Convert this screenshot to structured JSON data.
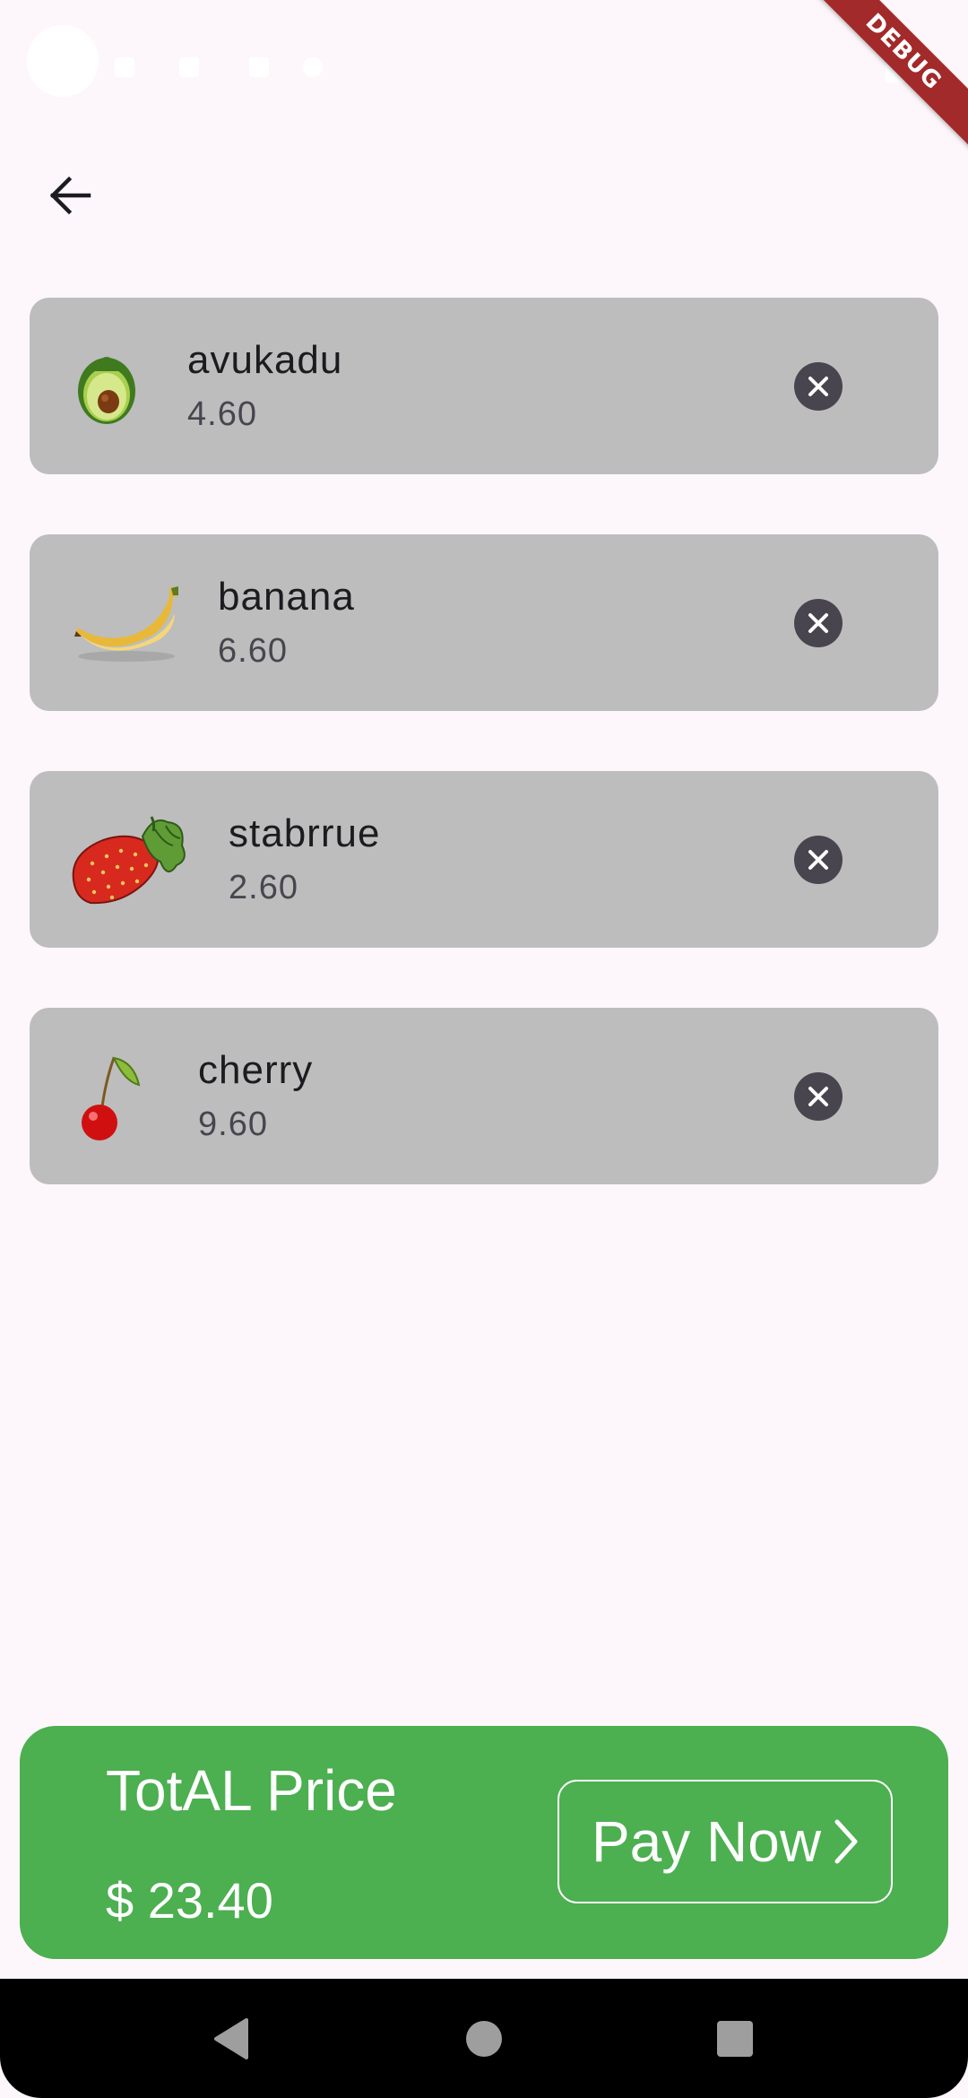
{
  "app": {
    "debug_banner": "DEBUG"
  },
  "icons": {
    "back": "arrow-left-icon",
    "remove": "close-circle-icon",
    "pay_chevron": "chevron-right-icon",
    "nav_back": "triangle-back-icon",
    "nav_home": "circle-home-icon",
    "nav_recents": "square-recents-icon"
  },
  "cart": {
    "items": [
      {
        "name": "avukadu",
        "price": "4.60",
        "image": "avocado"
      },
      {
        "name": "banana",
        "price": "6.60",
        "image": "banana"
      },
      {
        "name": "stabrrue",
        "price": "2.60",
        "image": "strawberry"
      },
      {
        "name": "cherry",
        "price": "9.60",
        "image": "cherry"
      }
    ]
  },
  "checkout": {
    "total_label": "TotAL Price",
    "total_value": "$ 23.40",
    "pay_label": "Pay Now"
  },
  "colors": {
    "background": "#fdf7fc",
    "item_card": "#bdbdbd",
    "accent_green": "#4caf50",
    "remove_icon": "#49454f",
    "debug_ribbon": "#a32a2a"
  }
}
